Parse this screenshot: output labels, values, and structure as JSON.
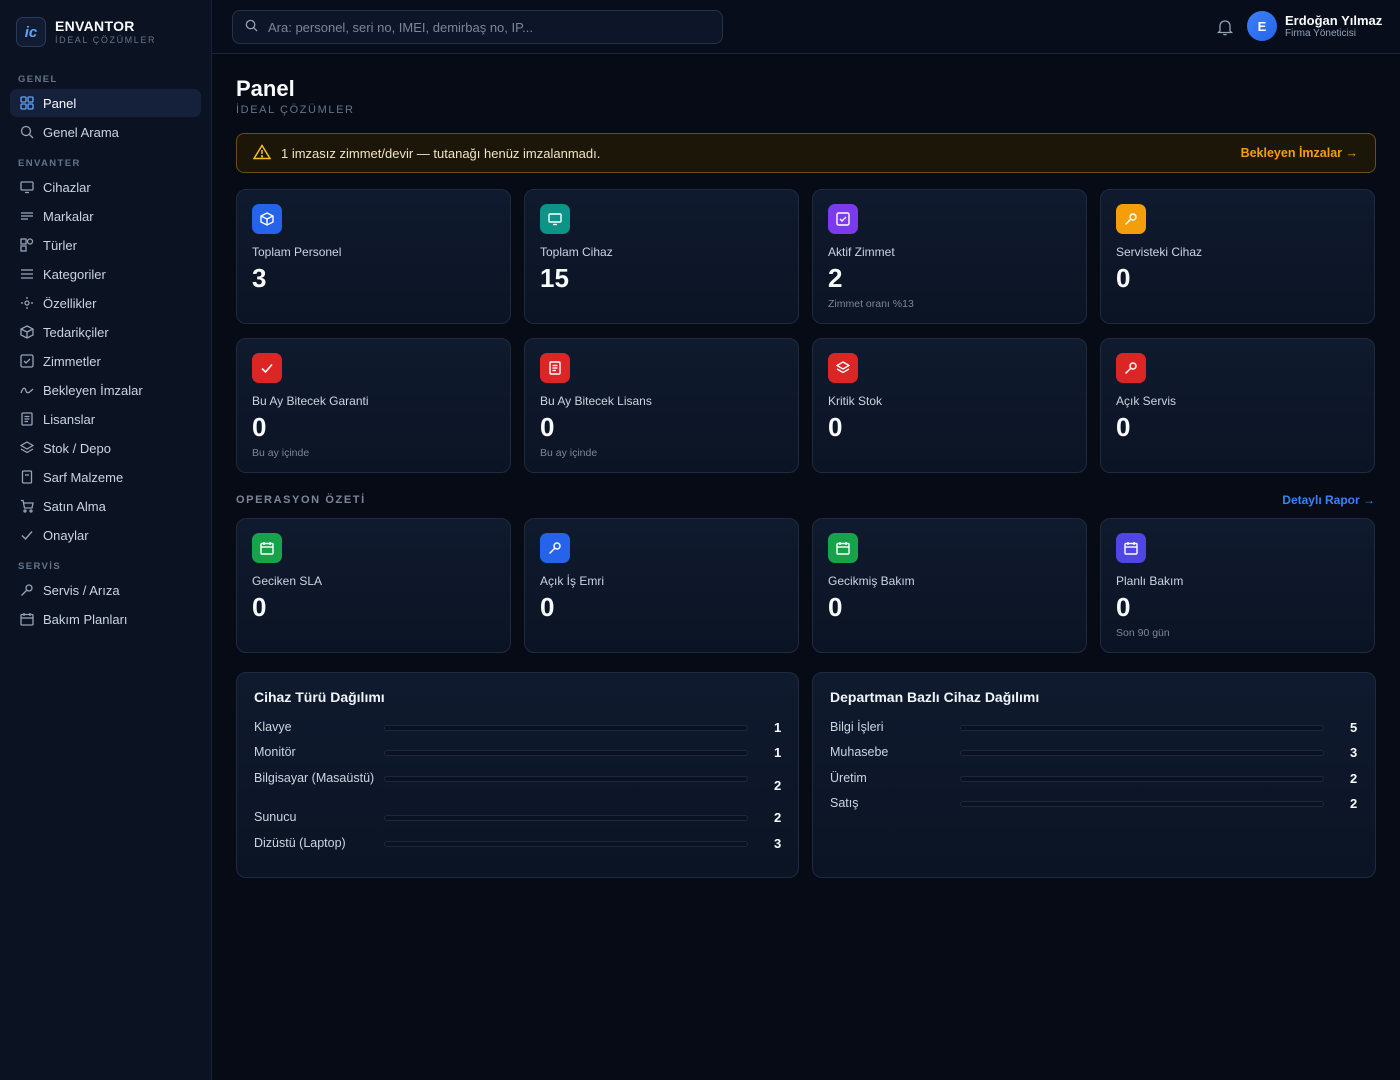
{
  "brand": {
    "logo": "ic",
    "name": "ENVANTOR",
    "sub": "İDEAL ÇÖZÜMLER"
  },
  "nav": {
    "sections": {
      "genel": "GENEL",
      "envanter": "ENVANTER",
      "servis": "SERVİS"
    },
    "items": [
      {
        "label": "Panel",
        "icon": "grid-icon"
      },
      {
        "label": "Genel Arama",
        "icon": "search-icon"
      },
      {
        "label": "Cihazlar",
        "icon": "monitor-icon"
      },
      {
        "label": "Markalar",
        "icon": "lines-icon"
      },
      {
        "label": "Türler",
        "icon": "shapes-icon"
      },
      {
        "label": "Kategoriler",
        "icon": "list-icon"
      },
      {
        "label": "Özellikler",
        "icon": "sparkle-icon"
      },
      {
        "label": "Tedarikçiler",
        "icon": "box-icon"
      },
      {
        "label": "Zimmetler",
        "icon": "check-square-icon"
      },
      {
        "label": "Bekleyen İmzalar",
        "icon": "signature-icon"
      },
      {
        "label": "Lisanslar",
        "icon": "document-icon"
      },
      {
        "label": "Stok / Depo",
        "icon": "layers-icon"
      },
      {
        "label": "Sarf Malzeme",
        "icon": "file-icon"
      },
      {
        "label": "Satın Alma",
        "icon": "cart-icon"
      },
      {
        "label": "Onaylar",
        "icon": "check-icon"
      },
      {
        "label": "Servis / Arıza",
        "icon": "wrench-icon"
      },
      {
        "label": "Bakım Planları",
        "icon": "calendar-icon"
      }
    ]
  },
  "search": {
    "placeholder": "Ara: personel, seri no, IMEI, demirbaş no, IP..."
  },
  "user": {
    "initial": "E",
    "name": "Erdoğan Yılmaz",
    "role": "Firma Yöneticisi"
  },
  "page": {
    "title": "Panel",
    "subtitle": "İDEAL ÇÖZÜMLER"
  },
  "alert": {
    "text": "1 imzasız zimmet/devir — tutanağı henüz imzalanmadı.",
    "link": "Bekleyen İmzalar →"
  },
  "stats": [
    {
      "label": "Toplam Personel",
      "value": "3",
      "note": "",
      "icon": "box-icon",
      "color": "#2563eb"
    },
    {
      "label": "Toplam Cihaz",
      "value": "15",
      "note": "",
      "icon": "monitor-icon",
      "color": "#0d9488"
    },
    {
      "label": "Aktif Zimmet",
      "value": "2",
      "note": "Zimmet oranı %13",
      "icon": "check-square-icon",
      "color": "#7c3aed"
    },
    {
      "label": "Servisteki Cihaz",
      "value": "0",
      "note": "",
      "icon": "wrench-icon",
      "color": "#f59e0b"
    },
    {
      "label": "Bu Ay Bitecek Garanti",
      "value": "0",
      "note": "Bu ay içinde",
      "icon": "check-icon",
      "color": "#dc2626"
    },
    {
      "label": "Bu Ay Bitecek Lisans",
      "value": "0",
      "note": "Bu ay içinde",
      "icon": "document-icon",
      "color": "#dc2626"
    },
    {
      "label": "Kritik Stok",
      "value": "0",
      "note": "",
      "icon": "layers-icon",
      "color": "#dc2626"
    },
    {
      "label": "Açık Servis",
      "value": "0",
      "note": "",
      "icon": "wrench-icon",
      "color": "#dc2626"
    }
  ],
  "ops": {
    "title": "OPERASYON ÖZETİ",
    "link": "Detaylı Rapor →",
    "items": [
      {
        "label": "Geciken SLA",
        "value": "0",
        "note": "",
        "icon": "calendar-icon",
        "color": "#16a34a"
      },
      {
        "label": "Açık İş Emri",
        "value": "0",
        "note": "",
        "icon": "wrench-icon",
        "color": "#2563eb"
      },
      {
        "label": "Gecikmiş Bakım",
        "value": "0",
        "note": "",
        "icon": "calendar-icon",
        "color": "#16a34a"
      },
      {
        "label": "Planlı Bakım",
        "value": "0",
        "note": "Son 90 gün",
        "icon": "calendar-icon",
        "color": "#4f46e5"
      }
    ]
  },
  "device_types": {
    "title": "Cihaz Türü Dağılımı",
    "rows": [
      {
        "label": "Klavye",
        "value": "1"
      },
      {
        "label": "Monitör",
        "value": "1"
      },
      {
        "label": "Bilgisayar (Masaüstü)",
        "value": "2"
      },
      {
        "label": "Sunucu",
        "value": "2"
      },
      {
        "label": "Dizüstü (Laptop)",
        "value": "3"
      }
    ]
  },
  "departments": {
    "title": "Departman Bazlı Cihaz Dağılımı",
    "rows": [
      {
        "label": "Bilgi İşleri",
        "value": "5"
      },
      {
        "label": "Muhasebe",
        "value": "3"
      },
      {
        "label": "Üretim",
        "value": "2"
      },
      {
        "label": "Satış",
        "value": "2"
      }
    ]
  }
}
